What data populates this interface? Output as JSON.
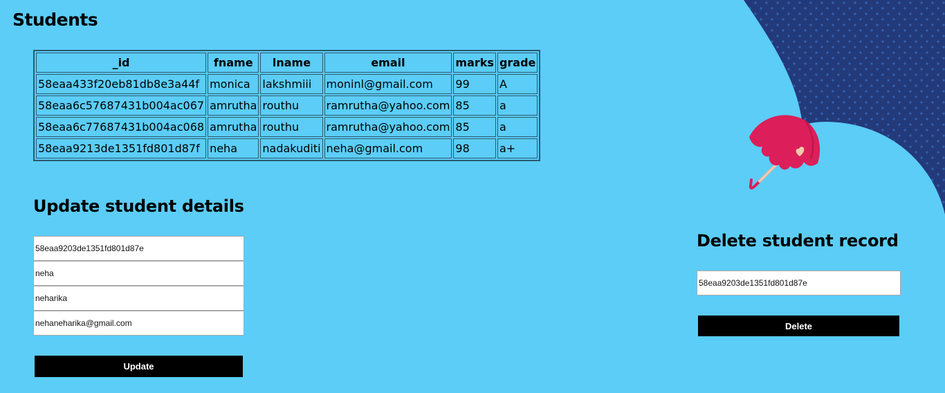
{
  "page": {
    "title": "Students"
  },
  "table": {
    "headers": [
      "_id",
      "fname",
      "lname",
      "email",
      "marks",
      "grade"
    ],
    "rows": [
      [
        "58eaa433f20eb81db8e3a44f",
        "monica",
        "lakshmiii",
        "moninl@gmail.com",
        "99",
        "A"
      ],
      [
        "58eaa6c57687431b004ac067",
        "amrutha",
        "routhu",
        "ramrutha@yahoo.com",
        "85",
        "a"
      ],
      [
        "58eaa6c77687431b004ac068",
        "amrutha",
        "routhu",
        "ramrutha@yahoo.com",
        "85",
        "a"
      ],
      [
        "58eaa9213de1351fd801d87f",
        "neha",
        "nadakuditi",
        "neha@gmail.com",
        "98",
        "a+"
      ]
    ]
  },
  "update": {
    "title": "Update student details",
    "id_value": "58eaa9203de1351fd801d87e",
    "fname_value": "neha",
    "lname_value": "neharika",
    "email_value": "nehaneharika@gmail.com",
    "button_label": "Update"
  },
  "delete": {
    "title": "Delete student record",
    "id_value": "58eaa9203de1351fd801d87e",
    "button_label": "Delete"
  },
  "colors": {
    "background": "#5bcdf7",
    "decor_navy": "#233a7a",
    "umbrella": "#dc1e5a",
    "button": "#000000"
  },
  "icons": {
    "umbrella": "umbrella-icon"
  }
}
